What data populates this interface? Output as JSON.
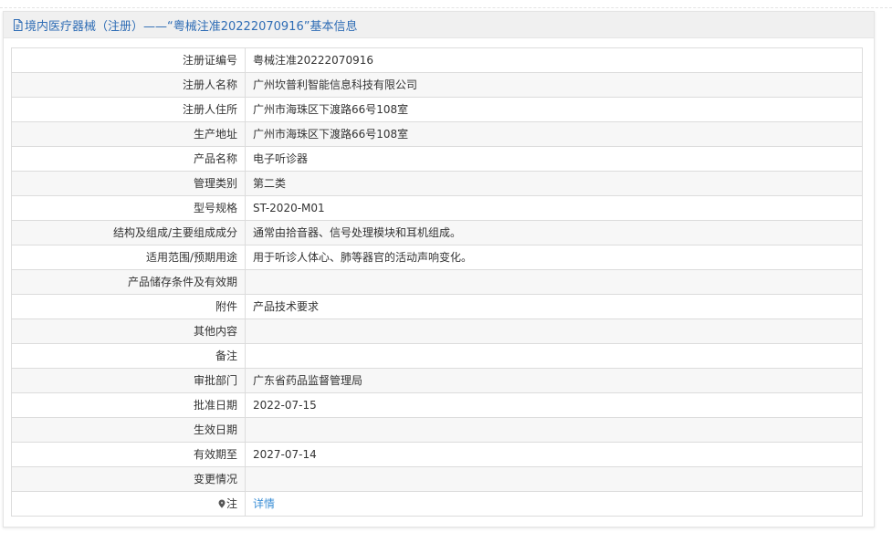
{
  "header": {
    "icon": "document-icon",
    "title": "境内医疗器械（注册）——“粤械注准20222070916”基本信息"
  },
  "rows": [
    {
      "label": "注册证编号",
      "value": "粤械注准20222070916"
    },
    {
      "label": "注册人名称",
      "value": "广州坎普利智能信息科技有限公司"
    },
    {
      "label": "注册人住所",
      "value": "广州市海珠区下渡路66号108室"
    },
    {
      "label": "生产地址",
      "value": "广州市海珠区下渡路66号108室"
    },
    {
      "label": "产品名称",
      "value": "电子听诊器"
    },
    {
      "label": "管理类别",
      "value": "第二类"
    },
    {
      "label": "型号规格",
      "value": "ST-2020-M01"
    },
    {
      "label": "结构及组成/主要组成成分",
      "value": "通常由拾音器、信号处理模块和耳机组成。"
    },
    {
      "label": "适用范围/预期用途",
      "value": "用于听诊人体心、肺等器官的活动声响变化。"
    },
    {
      "label": "产品储存条件及有效期",
      "value": ""
    },
    {
      "label": "附件",
      "value": "产品技术要求"
    },
    {
      "label": "其他内容",
      "value": ""
    },
    {
      "label": "备注",
      "value": ""
    },
    {
      "label": "审批部门",
      "value": "广东省药品监督管理局"
    },
    {
      "label": "批准日期",
      "value": "2022-07-15"
    },
    {
      "label": "生效日期",
      "value": ""
    },
    {
      "label": "有效期至",
      "value": "2027-07-14"
    },
    {
      "label": "变更情况",
      "value": ""
    },
    {
      "label": "注",
      "icon": "pin-icon",
      "value": "详情"
    }
  ],
  "colors": {
    "title": "#2f6db5",
    "link": "#3b8fd6",
    "text": "#333333",
    "header_bg": "#f0f0f0",
    "border": "#dcdcdc"
  }
}
